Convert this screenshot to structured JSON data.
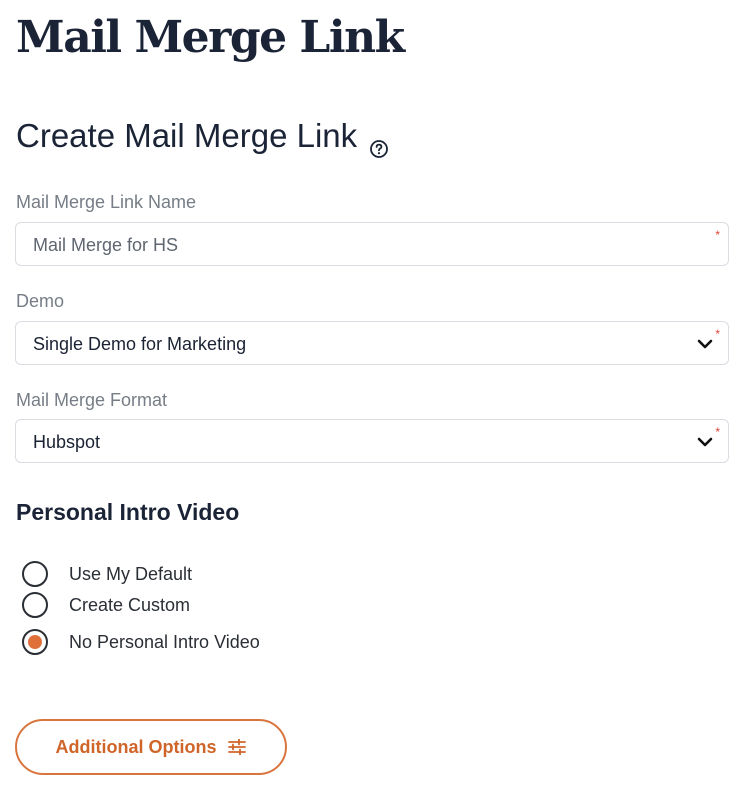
{
  "page": {
    "title": "Mail Merge Link"
  },
  "section": {
    "title": "Create Mail Merge Link",
    "help_icon": "question-circle-icon"
  },
  "form": {
    "name_field": {
      "label": "Mail Merge Link Name",
      "value": "Mail Merge for HS",
      "required_mark": "*"
    },
    "demo_field": {
      "label": "Demo",
      "value": "Single Demo for Marketing",
      "required_mark": "*",
      "icon": "chevron-down-icon"
    },
    "format_field": {
      "label": "Mail Merge Format",
      "value": "Hubspot",
      "required_mark": "*",
      "icon": "chevron-down-icon"
    }
  },
  "intro_video": {
    "heading": "Personal Intro Video",
    "options": [
      {
        "label": "Use My Default",
        "checked": false
      },
      {
        "label": "Create Custom",
        "checked": false
      },
      {
        "label": "No Personal Intro Video",
        "checked": true
      }
    ]
  },
  "actions": {
    "additional_options_label": "Additional Options",
    "icon": "sliders-icon"
  },
  "colors": {
    "accent": "#d9753f",
    "required": "#e0443a",
    "heading": "#1b2436",
    "label": "#767d86"
  }
}
